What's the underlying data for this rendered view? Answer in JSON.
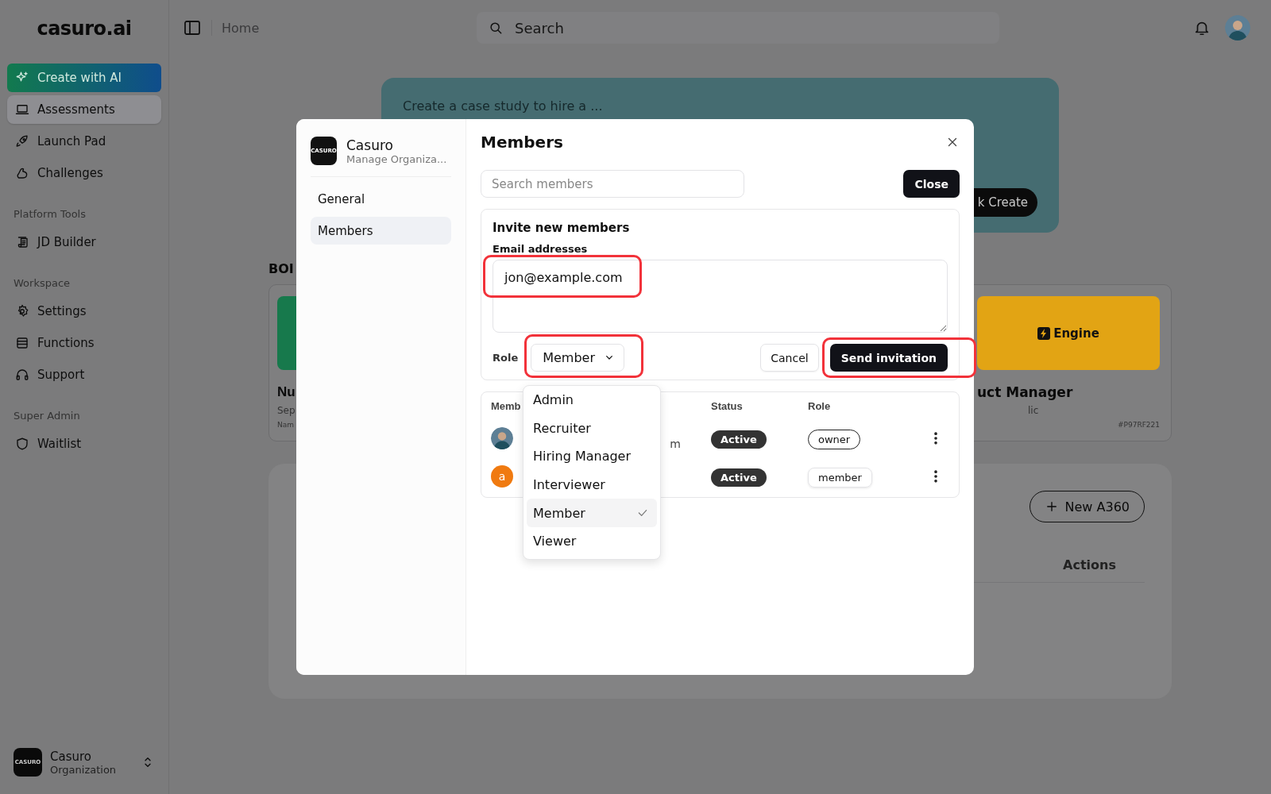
{
  "sidebar": {
    "logo": {
      "text": "casuro",
      "accent": ".ai"
    },
    "create_button": "Create with AI",
    "groups": [
      {
        "items": [
          {
            "label": "Assessments",
            "selected": true
          },
          {
            "label": "Launch Pad",
            "selected": false
          },
          {
            "label": "Challenges",
            "selected": false
          }
        ]
      },
      {
        "heading": "Platform Tools",
        "items": [
          {
            "label": "JD Builder",
            "selected": false
          }
        ]
      },
      {
        "heading": "Workspace",
        "items": [
          {
            "label": "Settings",
            "selected": false
          },
          {
            "label": "Functions",
            "selected": false
          },
          {
            "label": "Support",
            "selected": false
          }
        ]
      },
      {
        "heading": "Super Admin",
        "items": [
          {
            "label": "Waitlist",
            "selected": false
          }
        ]
      }
    ],
    "org_switcher": {
      "logo_text": "CASURO",
      "name": "Casuro",
      "subtitle": "Organization"
    }
  },
  "topbar": {
    "breadcrumb": "Home",
    "search": {
      "placeholder": "Search"
    }
  },
  "background": {
    "hero": {
      "prompt": "Create a case study to hire a ...",
      "button": "k Create"
    },
    "section_heading": "BOI",
    "cards": [
      {
        "title": "Nu",
        "subtitle": "Sep",
        "meta": "Nam",
        "color": "#17794c"
      },
      {
        "banner_text": "Engine",
        "title": "uct Manager",
        "subtitle": "lic",
        "meta": "#P97RF221",
        "color": "#e2a414"
      }
    ],
    "panel": {
      "button": "New A360",
      "columns": [
        "Actions"
      ]
    }
  },
  "modal": {
    "org": {
      "logo_text": "CASURO",
      "name": "Casuro",
      "subtitle": "Manage Organiza..."
    },
    "nav": [
      {
        "label": "General",
        "selected": false
      },
      {
        "label": "Members",
        "selected": true
      }
    ],
    "title": "Members",
    "search": {
      "placeholder": "Search members"
    },
    "close_button": "Close",
    "invite": {
      "title": "Invite new members",
      "email_label": "Email addresses",
      "emails": "jon@example.com",
      "role_label": "Role",
      "role_value": "Member",
      "cancel": "Cancel",
      "send": "Send invitation"
    },
    "members": {
      "columns": [
        "Memb",
        "Status",
        "Role"
      ],
      "rows": [
        {
          "avatar": {
            "kind": "photo"
          },
          "email": "m",
          "status": "Active",
          "role": {
            "label": "owner",
            "kind": "outline"
          }
        },
        {
          "avatar": {
            "kind": "letter",
            "letter": "a"
          },
          "status": "Active",
          "role": {
            "label": "member",
            "kind": "plain"
          }
        }
      ]
    }
  },
  "role_dropdown": {
    "options": [
      {
        "label": "Admin",
        "selected": false
      },
      {
        "label": "Recruiter",
        "selected": false
      },
      {
        "label": "Hiring Manager",
        "selected": false
      },
      {
        "label": "Interviewer",
        "selected": false
      },
      {
        "label": "Member",
        "selected": true
      },
      {
        "label": "Viewer",
        "selected": false
      }
    ]
  },
  "annotations": [
    {
      "kind": "outline"
    },
    {
      "kind": "outline"
    },
    {
      "kind": "outline"
    }
  ]
}
